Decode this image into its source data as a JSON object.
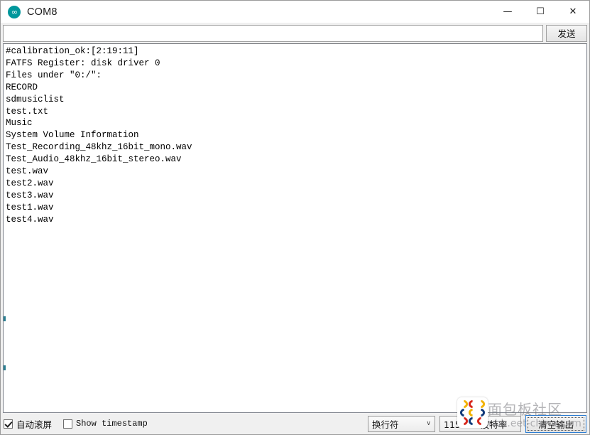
{
  "window": {
    "title": "COM8",
    "app_icon": "arduino-logo-icon",
    "controls": {
      "minimize": "—",
      "maximize": "☐",
      "close": "✕"
    }
  },
  "send_bar": {
    "input_value": "",
    "input_placeholder": "",
    "send_label": "发送"
  },
  "console": {
    "lines": [
      "#calibration_ok:[2:19:11]",
      "FATFS Register: disk driver 0",
      "Files under \"0:/\":",
      "RECORD",
      "sdmusiclist",
      "test.txt",
      "Music",
      "System Volume Information",
      "Test_Recording_48khz_16bit_mono.wav",
      "Test_Audio_48khz_16bit_stereo.wav",
      "test.wav",
      "test2.wav",
      "test3.wav",
      "test1.wav",
      "test4.wav"
    ]
  },
  "status_bar": {
    "autoscroll_label": "自动滚屏",
    "autoscroll_checked": true,
    "timestamp_label": "Show timestamp",
    "timestamp_checked": false,
    "newline_value": "换行符",
    "baud_value": "115200 波特率",
    "clear_label": "清空输出",
    "chevron": "∨"
  },
  "watermark": {
    "cn_text": "面包板社区",
    "url_text": "mbb.eet-china.com"
  },
  "colors": {
    "accent_teal": "#00979c",
    "focus_blue": "#2d7dd2",
    "toolbar_bg": "#f0f0f0",
    "console_bg": "#ffffff",
    "text": "#000000"
  }
}
